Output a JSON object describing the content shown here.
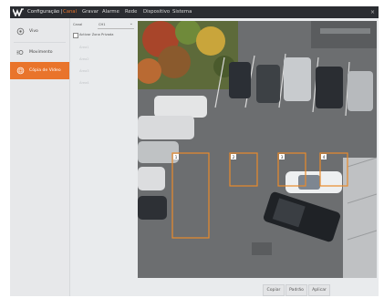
{
  "titlebar": {
    "logo_icon": "w-logo-icon",
    "title": "Configuração |",
    "menu": [
      {
        "label": "Canal",
        "active": true
      },
      {
        "label": "Gravar"
      },
      {
        "label": "Alarme"
      },
      {
        "label": "Rede"
      },
      {
        "label": "Dispositivo"
      },
      {
        "label": "Sistema"
      }
    ],
    "close_glyph": "×"
  },
  "sidebar": {
    "items": [
      {
        "label": "Vivo",
        "icon": "camera-icon"
      },
      {
        "label": "Movimento",
        "icon": "motion-icon"
      },
      {
        "label": "Cópia de Vídeo",
        "icon": "video-copy-icon",
        "active": true
      }
    ]
  },
  "controls": {
    "canal_label": "Canal",
    "canal_value": "CH1",
    "enable_label": "Activar Zona Privada",
    "areas": [
      "Área1",
      "Área2",
      "Área3",
      "Área4"
    ]
  },
  "video": {
    "zones": [
      {
        "label": "1"
      },
      {
        "label": "2"
      },
      {
        "label": "3"
      },
      {
        "label": "4"
      }
    ]
  },
  "footer": {
    "copy_label": "Copiar",
    "default_label": "Padrão",
    "apply_label": "Aplicar"
  },
  "colors": {
    "accent": "#e9742b",
    "titlebar": "#2a2c31",
    "zone_border": "#e98a2a"
  }
}
